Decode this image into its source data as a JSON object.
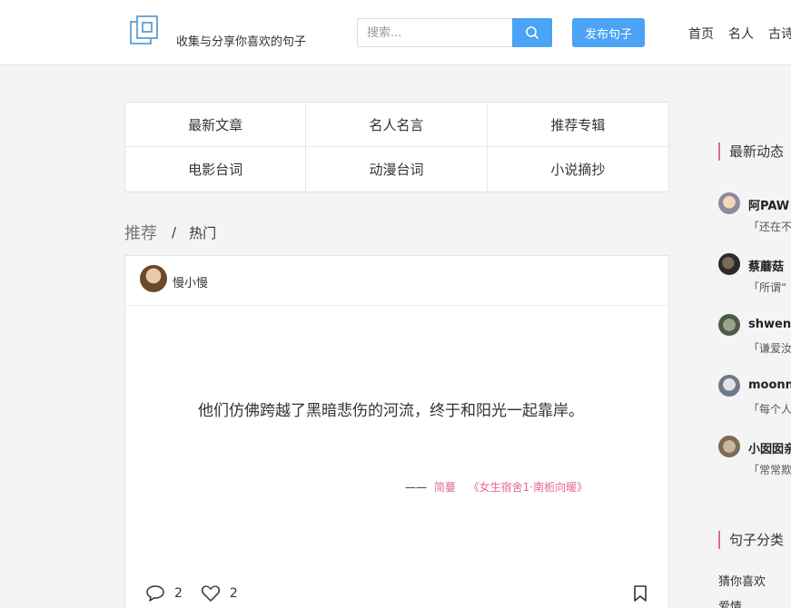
{
  "header": {
    "tagline": "收集与分享你喜欢的句子",
    "search_placeholder": "搜索...",
    "publish_label": "发布句子",
    "nav": [
      "首页",
      "名人",
      "古诗"
    ]
  },
  "categories": [
    "最新文章",
    "名人名言",
    "推荐专辑",
    "电影台词",
    "动漫台词",
    "小说摘抄"
  ],
  "tabs": {
    "recommended": "推荐",
    "separator": "/",
    "hot": "热门"
  },
  "post": {
    "user": "慢小慢",
    "quote": "他们仿佛跨越了黑暗悲伤的河流，终于和阳光一起靠岸。",
    "source_dash": "——",
    "source_author": "简蔓",
    "source_book": "《女生宿舍1·南栀向暖》",
    "comments": "2",
    "likes": "2"
  },
  "sidebar": {
    "activity_title": "最新动态",
    "feed": [
      {
        "name": "阿PAW",
        "text": "「还在不"
      },
      {
        "name": "蔡蘑菇",
        "text": "「所谓“"
      },
      {
        "name": "shwen",
        "text": "「谦爱汝"
      },
      {
        "name": "moonn",
        "text": "「每个人"
      },
      {
        "name": "小囡囡亲",
        "text": "「常常欺"
      }
    ],
    "category_title": "句子分类",
    "category_links": [
      "猜你喜欢",
      "爱情"
    ]
  },
  "colors": {
    "accent": "#4aa3f5",
    "pink": "#e56b8c"
  }
}
